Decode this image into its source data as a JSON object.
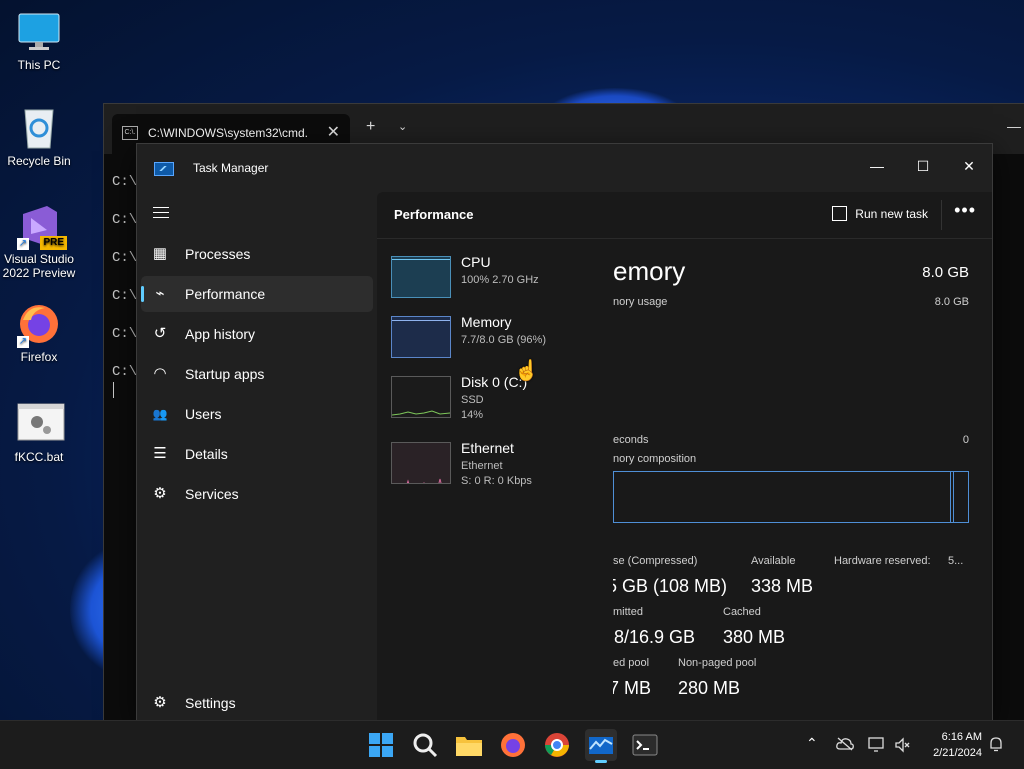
{
  "desktop": {
    "icons": [
      {
        "label": "This PC",
        "icon": "monitor-icon"
      },
      {
        "label": "Recycle Bin",
        "icon": "recycle-bin-icon"
      },
      {
        "label": "Visual Studio 2022 Preview",
        "badge": "PRE",
        "icon": "visual-studio-icon"
      },
      {
        "label": "Firefox",
        "icon": "firefox-icon"
      },
      {
        "label": "fKCC.bat",
        "icon": "batch-file-icon"
      }
    ]
  },
  "cmd": {
    "tab_title": "C:\\WINDOWS\\system32\\cmd.",
    "tab_icon_text": "C:\\.",
    "close_glyph": "✕",
    "new_tab_glyph": "+",
    "dropdown_glyph": "⌄",
    "minimize_glyph": "—",
    "lines": [
      "C:\\",
      "C:\\",
      "C:\\",
      "C:\\",
      "C:\\",
      "C:\\"
    ]
  },
  "task_manager": {
    "title": "Task Manager",
    "window_buttons": {
      "minimize": "—",
      "maximize": "☐",
      "close": "✕"
    },
    "nav": [
      {
        "label": "Processes",
        "icon": "processes-icon",
        "glyph": "▦"
      },
      {
        "label": "Performance",
        "icon": "performance-icon",
        "glyph": "⌁",
        "active": true
      },
      {
        "label": "App history",
        "icon": "app-history-icon",
        "glyph": "↺"
      },
      {
        "label": "Startup apps",
        "icon": "startup-apps-icon",
        "glyph": "◠"
      },
      {
        "label": "Users",
        "icon": "users-icon",
        "glyph": "👥"
      },
      {
        "label": "Details",
        "icon": "details-icon",
        "glyph": "☰"
      },
      {
        "label": "Services",
        "icon": "services-icon",
        "glyph": "⚙"
      }
    ],
    "settings": {
      "label": "Settings",
      "glyph": "⚙"
    },
    "header": {
      "title": "Performance",
      "run_new_task": "Run new task",
      "more": "•••"
    },
    "resources": [
      {
        "name": "CPU",
        "line2": "100%  2.70 GHz",
        "line3": "",
        "level": 1.0
      },
      {
        "name": "Memory",
        "line2": "7.7/8.0 GB (96%)",
        "line3": "",
        "level": 0.96
      },
      {
        "name": "Disk 0 (C:)",
        "line2": "SSD",
        "line3": "14%",
        "level": 0.14
      },
      {
        "name": "Ethernet",
        "line2": "Ethernet",
        "line3": "S: 0  R: 0 Kbps",
        "level": 0.0
      }
    ],
    "detail": {
      "title": "emory",
      "total": "8.0 GB",
      "usage_label": "nory usage",
      "usage_right": "8.0 GB",
      "seconds_label": "econds",
      "seconds_right": "0",
      "composition_label": "nory composition",
      "stats": [
        {
          "label": "se (Compressed)",
          "value": "5 GB (108 MB)"
        },
        {
          "label": "Available",
          "value": "338 MB"
        },
        {
          "label": "Hardware reserved:",
          "value": "5..."
        },
        {
          "label": "mitted",
          "value": ".8/16.9 GB"
        },
        {
          "label": "Cached",
          "value": "380 MB"
        },
        {
          "label": "ed pool",
          "value": "7 MB"
        },
        {
          "label": "Non-paged pool",
          "value": "280 MB"
        }
      ]
    }
  },
  "taskbar": {
    "apps": [
      "start-icon",
      "search-icon",
      "file-explorer-icon",
      "firefox-icon",
      "chrome-icon",
      "task-manager-icon",
      "terminal-icon"
    ],
    "tray": {
      "chevron": "⌃"
    },
    "time": "6:16 AM",
    "date": "2/21/2024"
  },
  "colors": {
    "accent": "#60cdff",
    "chart_blue": "#4f8fd6",
    "window_bg": "#202020"
  }
}
